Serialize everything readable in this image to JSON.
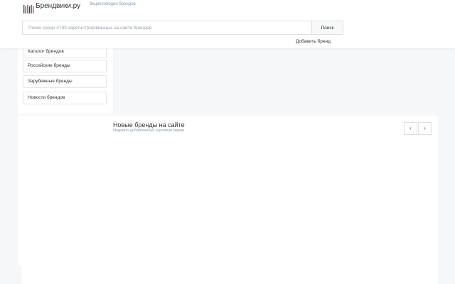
{
  "header": {
    "brand_name": "Брендвики.ру",
    "tagline": "Энциклопедия брендов",
    "logo_icon": "barcode-logo-icon",
    "search": {
      "placeholder": "Поиск среди 4799 зарегистрированных на сайте брендов",
      "value": "",
      "button_label": "Поиск"
    },
    "add_brand_label": "Добавить бренд"
  },
  "sidebar": {
    "items": [
      {
        "label": "Каталог брендов"
      },
      {
        "label": "Российские бренды"
      },
      {
        "label": "Зарубежные бренды"
      },
      {
        "label": "Новости брендов"
      }
    ]
  },
  "new_brands": {
    "title": "Новые бренды на сайте",
    "subtitle": "Недавно добавленные торговые марки",
    "prev_icon": "chevron-left-icon",
    "next_icon": "chevron-right-icon",
    "prev_label": "‹",
    "next_label": "›"
  },
  "colors": {
    "background": "#f5f7f8",
    "panel": "#ffffff",
    "border": "#dcdfe3",
    "logo_accent": "#c0392b"
  }
}
